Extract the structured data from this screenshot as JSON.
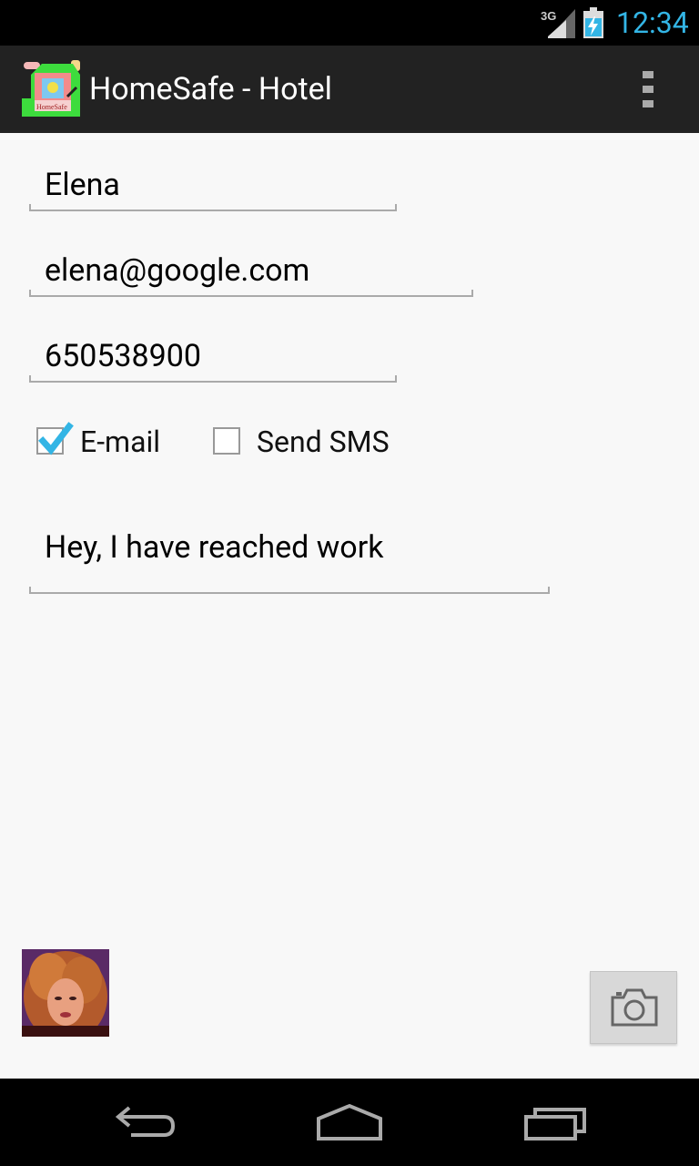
{
  "status_bar": {
    "network_type": "3G",
    "time": "12:34",
    "accent_color": "#33b5e5"
  },
  "action_bar": {
    "title": "HomeSafe - Hotel",
    "logo_icon": "homesafe-logo-icon",
    "logo_text": "HomeSafe",
    "overflow_icon": "overflow-menu-icon"
  },
  "form": {
    "name_value": "Elena",
    "email_value": "elena@google.com",
    "phone_value": "650538900",
    "email_checkbox": {
      "label": "E-mail",
      "checked": true
    },
    "sms_checkbox": {
      "label": "Send SMS",
      "checked": false
    },
    "message_value": "Hey, I have reached work"
  },
  "bottom": {
    "contact_photo": "contact-photo",
    "camera_icon": "camera-icon"
  },
  "nav_bar": {
    "back_icon": "back-icon",
    "home_icon": "home-icon",
    "recents_icon": "recents-icon"
  }
}
